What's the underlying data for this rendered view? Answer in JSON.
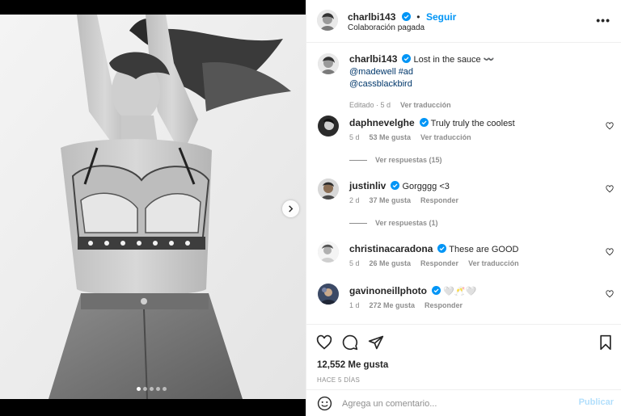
{
  "post": {
    "author": "charlbi143",
    "follow_label": "Seguir",
    "subtitle": "Colaboración pagada",
    "more_label": "•••"
  },
  "caption": {
    "author": "charlbi143",
    "text": "Lost in the sauce 〰️",
    "line2": "@madewell #ad",
    "line3": "@cassblackbird",
    "edited": "Editado · 5 d",
    "translate": "Ver traducción"
  },
  "comments": [
    {
      "user": "daphnevelghe",
      "text": "Truly truly the coolest",
      "age": "5 d",
      "likes": "53 Me gusta",
      "action": "Ver traducción",
      "replies": "Ver respuestas (15)"
    },
    {
      "user": "justinliv",
      "text": "Gorgggg <3",
      "age": "2 d",
      "likes": "37 Me gusta",
      "action": "Responder",
      "replies": "Ver respuestas (1)"
    },
    {
      "user": "christinacaradona",
      "text": "These are GOOD",
      "age": "5 d",
      "likes": "26 Me gusta",
      "action": "Responder",
      "action2": "Ver traducción"
    },
    {
      "user": "gavinoneillphoto",
      "text": "🤍🥂🤍",
      "age": "1 d",
      "likes": "272 Me gusta",
      "action": "Responder"
    }
  ],
  "footer": {
    "likes": "12,552 Me gusta",
    "ago": "HACE 5 DÍAS",
    "comment_placeholder": "Agrega un comentario...",
    "publish": "Publicar"
  },
  "carousel": {
    "slides": 5,
    "active": 0
  },
  "colors": {
    "accent": "#0095f6",
    "muted": "#8e8e8e",
    "link": "#00376b",
    "text": "#262626"
  },
  "icons": [
    "verified-badge-icon",
    "more-options-icon",
    "heart-icon",
    "comment-icon",
    "share-icon",
    "bookmark-icon",
    "emoji-icon",
    "chevron-right-icon"
  ]
}
